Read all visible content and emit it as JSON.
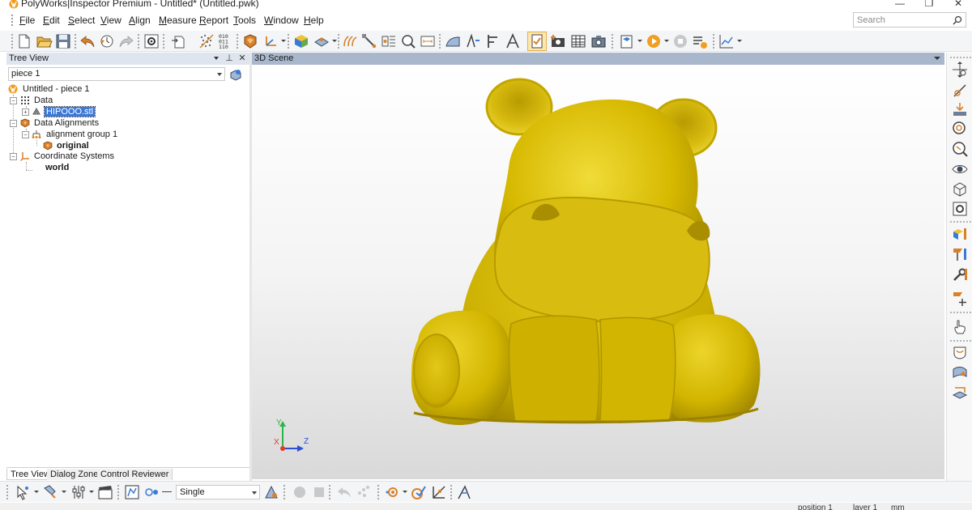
{
  "window": {
    "title": "PolyWorks|Inspector Premium - Untitled* (Untitled.pwk)",
    "minimize": "—",
    "restore": "❐",
    "close": "✕"
  },
  "menu": {
    "items": [
      {
        "label": "File",
        "u": "F",
        "rest": "ile"
      },
      {
        "label": "Edit",
        "u": "E",
        "rest": "dit"
      },
      {
        "label": "Select",
        "u": "S",
        "rest": "elect"
      },
      {
        "label": "View",
        "u": "V",
        "rest": "iew"
      },
      {
        "label": "Align",
        "u": "A",
        "rest": "lign"
      },
      {
        "label": "Measure",
        "u": "M",
        "rest": "easure"
      },
      {
        "label": "Report",
        "u": "R",
        "rest": "eport"
      },
      {
        "label": "Tools",
        "u": "T",
        "rest": "ools"
      },
      {
        "label": "Window",
        "u": "W",
        "rest": "indow"
      },
      {
        "label": "Help",
        "u": "H",
        "rest": "elp"
      }
    ]
  },
  "search": {
    "placeholder": "Search"
  },
  "toolbar": {
    "binary_icon_text": [
      "010",
      "011",
      "110"
    ]
  },
  "tree_view": {
    "title": "Tree View",
    "pin": "⊥",
    "close": "✕",
    "piece_selector": "piece 1",
    "items": {
      "root": "Untitled - piece 1",
      "data": "Data",
      "file": "HIPOOO.stl",
      "alignments": "Data Alignments",
      "group": "alignment group 1",
      "original": "original",
      "coord_systems": "Coordinate Systems",
      "world": "world"
    },
    "tabs": [
      "Tree View",
      "Dialog Zone",
      "Control Reviewer"
    ]
  },
  "scene": {
    "title": "3D Scene",
    "axis_labels": {
      "x": "X",
      "y": "Y",
      "z": "Z"
    }
  },
  "bottom_toolbar": {
    "selection_mode": "Single"
  },
  "status_bar": {
    "position": "position 1",
    "layer": "layer 1",
    "units": "mm"
  },
  "colors": {
    "model": "#d4b800",
    "model_shadow": "#9c8500",
    "model_highlight": "#f0de3a",
    "selection": "#3b78d8",
    "accent_orange": "#f0a020"
  }
}
